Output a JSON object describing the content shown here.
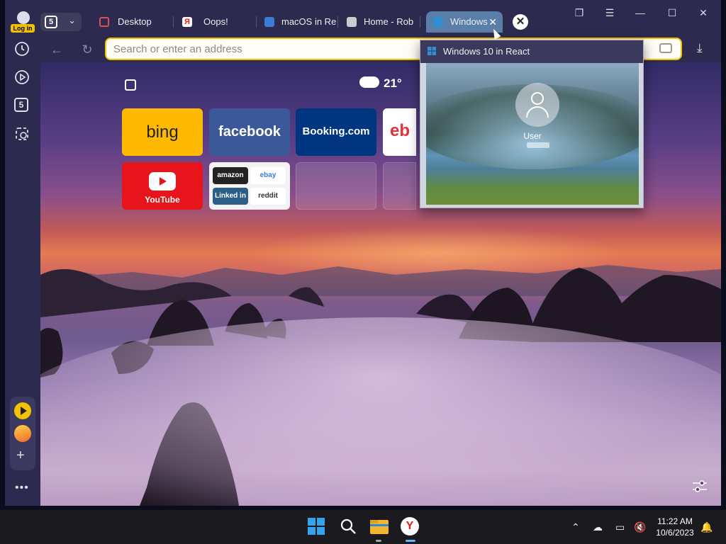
{
  "tabstrip": {
    "profile_badge": "Log in",
    "tab_count": "5",
    "tabs": [
      {
        "label": "Desktop"
      },
      {
        "label": "Oops!"
      },
      {
        "label": "macOS in Re"
      },
      {
        "label": "Home - Rob"
      },
      {
        "label": "Windows"
      }
    ]
  },
  "toolbar": {
    "address_placeholder": "Search or enter an address",
    "side_tab_count": "5"
  },
  "weather": {
    "temperature": "21°"
  },
  "tiles": {
    "bing": "bing",
    "facebook": "facebook",
    "booking": "Booking.com",
    "ebay_partial": "eb",
    "youtube": "YouTube",
    "group": [
      "amazon",
      "ebay",
      "Linked in",
      "reddit"
    ]
  },
  "preview": {
    "title": "Windows 10 in React",
    "user": "User"
  },
  "taskbar": {
    "time": "11:22 AM",
    "date": "10/6/2023"
  },
  "colors": {
    "accent_yellow": "#f2c200",
    "tab_bg": "#2c2a4f",
    "active_tab": "#5b7ea9"
  }
}
